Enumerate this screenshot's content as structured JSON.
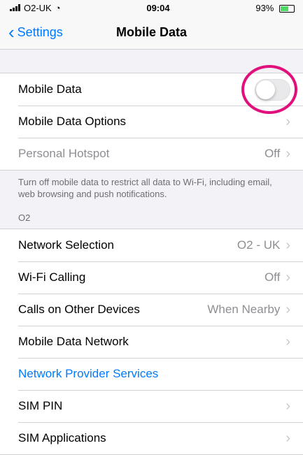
{
  "status_bar": {
    "carrier": "O2-UK",
    "time": "09:04",
    "battery": "93%"
  },
  "nav": {
    "back_label": "Settings",
    "title": "Mobile Data"
  },
  "group1": {
    "mobile_data_label": "Mobile Data",
    "mobile_data_enabled": false,
    "mobile_data_options_label": "Mobile Data Options"
  },
  "hotspot": {
    "label": "Personal Hotspot",
    "value": "Off"
  },
  "footer_note": "Turn off mobile data to restrict all data to Wi-Fi, including email, web browsing and push notifications.",
  "section_o2": {
    "header": "O2"
  },
  "carrier_rows": [
    {
      "label": "Network Selection",
      "value": "O2 - UK"
    },
    {
      "label": "Wi-Fi Calling",
      "value": "Off"
    },
    {
      "label": "Calls on Other Devices",
      "value": "When Nearby"
    },
    {
      "label": "Mobile Data Network",
      "value": ""
    },
    {
      "label": "Network Provider Services",
      "value": ""
    },
    {
      "label": "SIM PIN",
      "value": ""
    },
    {
      "label": "SIM Applications",
      "value": ""
    }
  ],
  "colors": {
    "accent": "#007aff",
    "annotation": "#e0107c"
  }
}
